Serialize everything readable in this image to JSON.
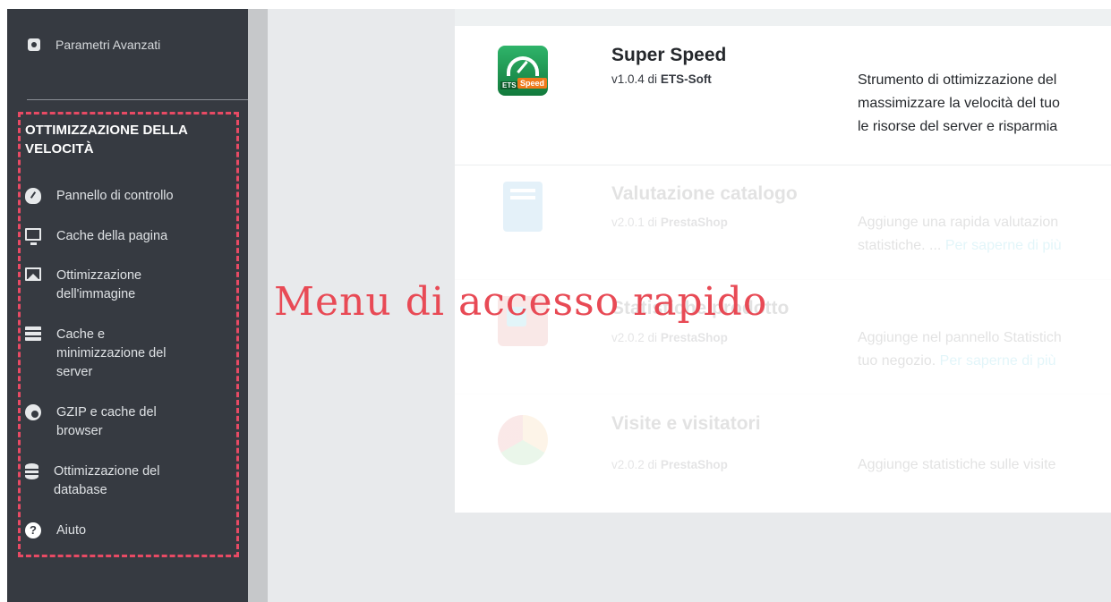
{
  "sidebar": {
    "top_items": [
      {
        "label": "Parametri Avanzati",
        "icon": "gear-icon"
      }
    ],
    "quick_menu": {
      "title": "OTTIMIZZAZIONE DELLA VELOCITÀ",
      "items": [
        {
          "label": "Pannello di controllo",
          "icon": "gauge-icon"
        },
        {
          "label": "Cache della pagina",
          "icon": "monitor-icon"
        },
        {
          "label": "Ottimizzazione dell'immagine",
          "icon": "image-icon"
        },
        {
          "label": "Cache e minimizzazione del server",
          "icon": "server-icon"
        },
        {
          "label": "GZIP e cache del browser",
          "icon": "chrome-icon"
        },
        {
          "label": "Ottimizzazione del database",
          "icon": "database-icon"
        },
        {
          "label": "Aiuto",
          "icon": "question-icon"
        }
      ]
    }
  },
  "modules": [
    {
      "name": "Super Speed",
      "version": "v1.0.4 di",
      "author": "ETS-Soft",
      "icon_labels": [
        "ETS",
        "Speed"
      ],
      "desc_lines": [
        "Strumento di ottimizzazione del",
        "massimizzare la velocità del tuo",
        "le risorse del server e risparmia"
      ]
    },
    {
      "name": "Valutazione catalogo",
      "version": "v2.0.1 di",
      "author": "PrestaShop",
      "desc_lines": [
        "Aggiunge una rapida valutazion",
        "statistiche. ..."
      ],
      "link": "Per saperne di più"
    },
    {
      "name": "Statistiche prodotto",
      "version": "v2.0.2 di",
      "author": "PrestaShop",
      "desc_lines": [
        "Aggiunge nel pannello Statistich",
        "tuo negozio."
      ],
      "link": "Per saperne di più"
    },
    {
      "name": "Visite e visitatori",
      "version": "v2.0.2 di",
      "author": "PrestaShop",
      "desc_lines": [
        "Aggiunge statistiche sulle visite"
      ]
    }
  ],
  "overlay": {
    "caption": "Menu di accesso rapido",
    "color": "#e84a55"
  },
  "colors": {
    "sidebar_bg": "#363a41",
    "highlight_border": "#e84a64",
    "link": "#25b9d7"
  }
}
